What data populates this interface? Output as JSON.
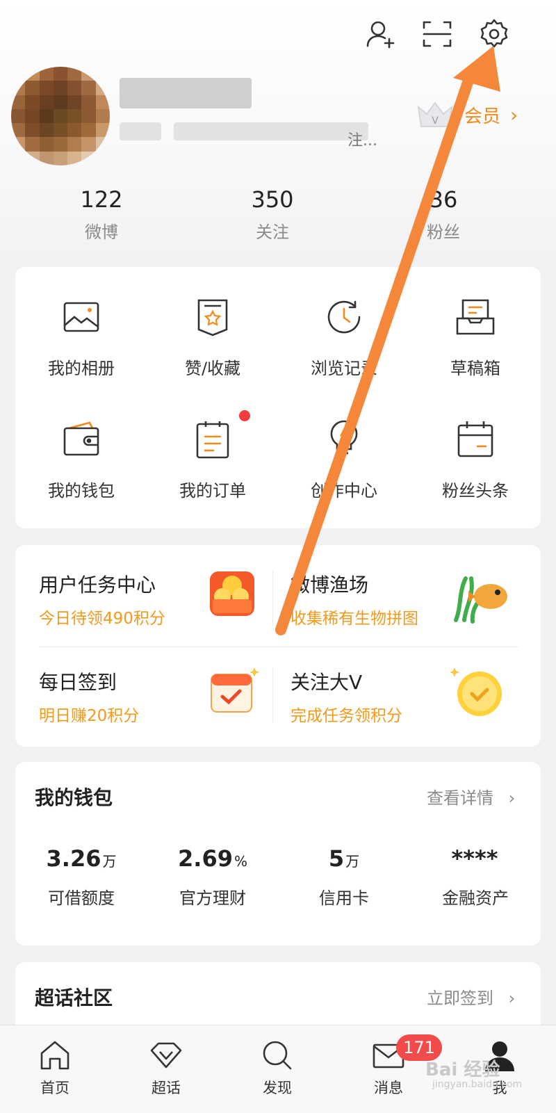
{
  "header": {
    "icons": [
      "add-friend-icon",
      "scan-icon",
      "gear-icon"
    ]
  },
  "profile": {
    "vip_label": "会员",
    "vip_arrow": "›",
    "bio_tail": "注..."
  },
  "stats": [
    {
      "num": "122",
      "label": "微博"
    },
    {
      "num": "350",
      "label": "关注"
    },
    {
      "num": "36",
      "label": "粉丝"
    }
  ],
  "grid": [
    {
      "label": "我的相册",
      "icon": "album-icon"
    },
    {
      "label": "赞/收藏",
      "icon": "favorite-icon"
    },
    {
      "label": "浏览记录",
      "icon": "history-icon"
    },
    {
      "label": "草稿箱",
      "icon": "drafts-icon"
    },
    {
      "label": "我的钱包",
      "icon": "wallet-icon"
    },
    {
      "label": "我的订单",
      "icon": "order-icon"
    },
    {
      "label": "创作中心",
      "icon": "creator-icon"
    },
    {
      "label": "粉丝头条",
      "icon": "calendar-icon"
    }
  ],
  "tasks": [
    {
      "title": "用户任务中心",
      "sub": "今日待领490积分"
    },
    {
      "title": "微博渔场",
      "sub": "收集稀有生物拼图"
    },
    {
      "title": "每日签到",
      "sub": "明日赚20积分"
    },
    {
      "title": "关注大V",
      "sub": "完成任务领积分"
    }
  ],
  "wallet": {
    "title": "我的钱包",
    "link": "查看详情",
    "items": [
      {
        "value": "3.26",
        "unit": "万",
        "label": "可借额度"
      },
      {
        "value": "2.69",
        "unit": "%",
        "label": "官方理财"
      },
      {
        "value": "5",
        "unit": "万",
        "label": "信用卡"
      },
      {
        "value": "****",
        "unit": "",
        "label": "金融资产"
      }
    ]
  },
  "community": {
    "title": "超话社区",
    "link": "立即签到"
  },
  "tabbar": {
    "tabs": [
      {
        "label": "首页",
        "icon": "home-icon"
      },
      {
        "label": "超话",
        "icon": "diamond-icon"
      },
      {
        "label": "发现",
        "icon": "search-icon"
      },
      {
        "label": "消息",
        "icon": "mail-icon"
      },
      {
        "label": "我",
        "icon": "person-icon"
      }
    ],
    "message_badge": "171"
  },
  "watermark": {
    "text": "Bai 经验",
    "url": "jingyan.baidu.com"
  },
  "colors": {
    "accent": "#f28a1a",
    "annotation_arrow": "#f5873a",
    "badge": "#f24b4b"
  }
}
